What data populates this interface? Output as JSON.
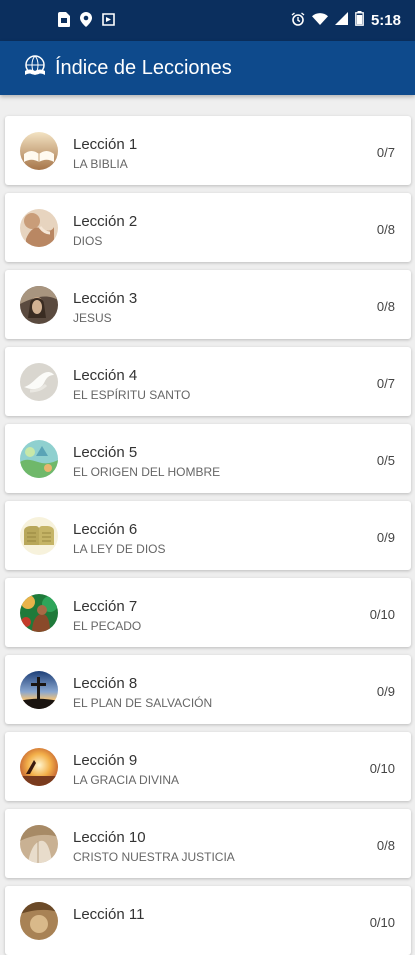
{
  "status_bar": {
    "time": "5:18",
    "icons": [
      "sd-card-icon",
      "location-icon",
      "cast-icon",
      "alarm-icon",
      "wifi-icon",
      "signal-icon",
      "battery-icon"
    ]
  },
  "app_bar": {
    "title": "Índice de Lecciones",
    "logo_icon": "globe-book-logo-icon"
  },
  "colors": {
    "status_bar_bg": "#0b2f5e",
    "app_bar_bg": "#0e4a8c",
    "page_bg": "#efefef",
    "card_bg": "#ffffff"
  },
  "lessons": [
    {
      "title": "Lección 1",
      "subtitle": "LA BIBLIA",
      "progress": "0/7",
      "icon": "open-bible-thumbnail"
    },
    {
      "title": "Lección 2",
      "subtitle": "DIOS",
      "progress": "0/8",
      "icon": "praying-hands-thumbnail"
    },
    {
      "title": "Lección 3",
      "subtitle": "JESUS",
      "progress": "0/8",
      "icon": "jesus-portrait-thumbnail"
    },
    {
      "title": "Lección 4",
      "subtitle": "EL ESPÍRITU SANTO",
      "progress": "0/7",
      "icon": "dove-thumbnail"
    },
    {
      "title": "Lección 5",
      "subtitle": "EL ORIGEN DEL HOMBRE",
      "progress": "0/5",
      "icon": "creation-thumbnail"
    },
    {
      "title": "Lección 6",
      "subtitle": "LA LEY DE DIOS",
      "progress": "0/9",
      "icon": "stone-tablets-thumbnail"
    },
    {
      "title": "Lección 7",
      "subtitle": "EL PECADO",
      "progress": "0/10",
      "icon": "garden-eden-thumbnail"
    },
    {
      "title": "Lección 8",
      "subtitle": "EL PLAN DE SALVACIÓN",
      "progress": "0/9",
      "icon": "cross-sunset-thumbnail"
    },
    {
      "title": "Lección 9",
      "subtitle": "LA GRACIA DIVINA",
      "progress": "0/10",
      "icon": "sunrise-figure-thumbnail"
    },
    {
      "title": "Lección 10",
      "subtitle": "CRISTO NUESTRA JUSTICIA",
      "progress": "0/8",
      "icon": "robe-thumbnail"
    },
    {
      "title": "Lección 11",
      "subtitle": "",
      "progress": "0/10",
      "icon": "lesson-11-thumbnail"
    }
  ]
}
